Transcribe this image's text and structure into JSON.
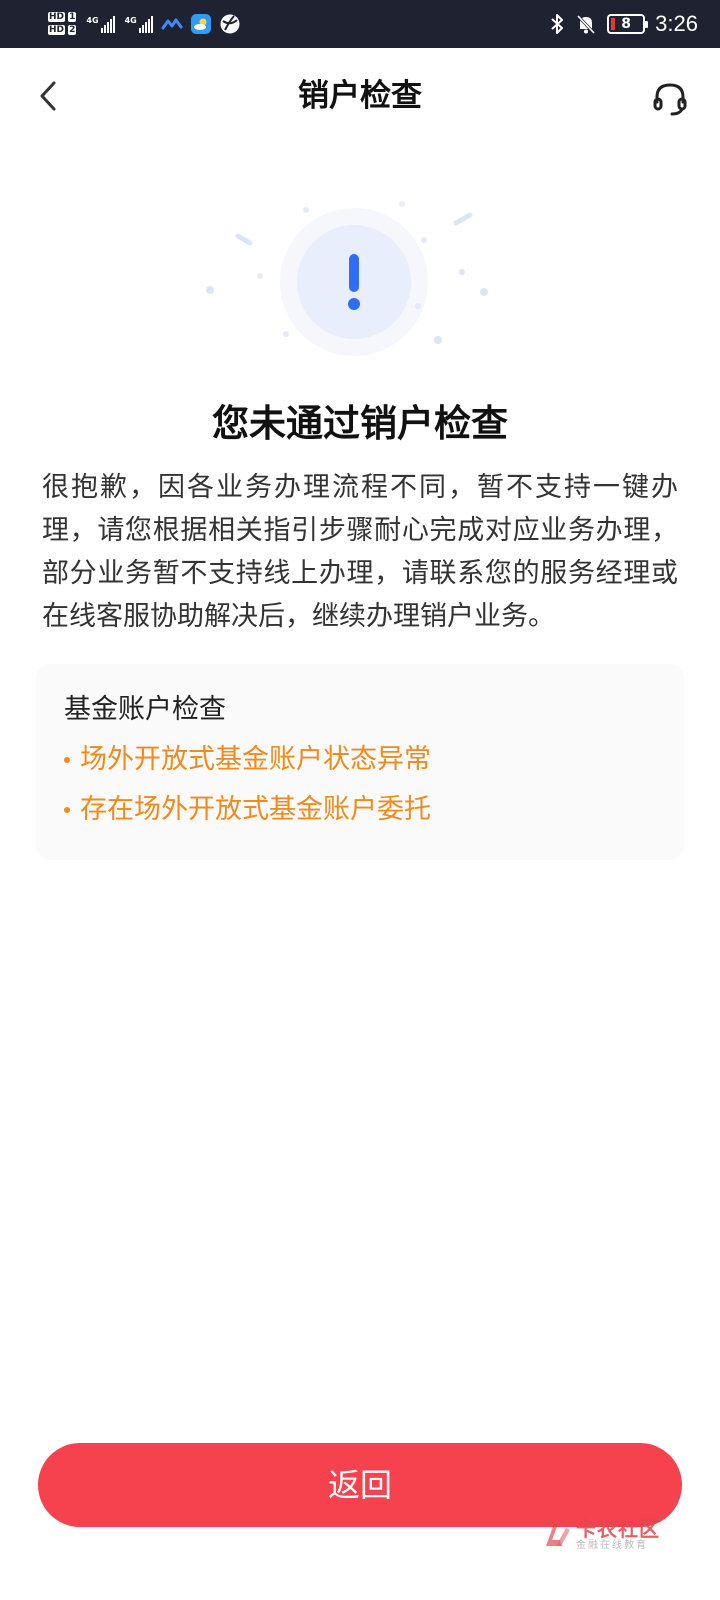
{
  "status_bar": {
    "hd1": "HD",
    "hd1_num": "1",
    "hd2": "HD",
    "hd2_num": "2",
    "net1": "4G",
    "net2": "4G",
    "battery": "8",
    "time": "3:26"
  },
  "nav": {
    "title": "销户检查"
  },
  "result": {
    "headline": "您未通过销户检查",
    "description": "很抱歉，因各业务办理流程不同，暂不支持一键办理，请您根据相关指引步骤耐心完成对应业务办理，部分业务暂不支持线上办理，请联系您的服务经理或在线客服协助解决后，继续办理销户业务。"
  },
  "check_card": {
    "title": "基金账户检查",
    "issues": [
      "场外开放式基金账户状态异常",
      "存在场外开放式基金账户委托"
    ]
  },
  "footer": {
    "return_label": "返回"
  },
  "watermark": {
    "main": "卡农社区",
    "sub": "金融在线教育"
  },
  "colors": {
    "primary_button": "#f5424e",
    "issue_text": "#f08a1c",
    "alert_icon": "#2f6df6",
    "status_bar_bg": "#1f2230"
  }
}
